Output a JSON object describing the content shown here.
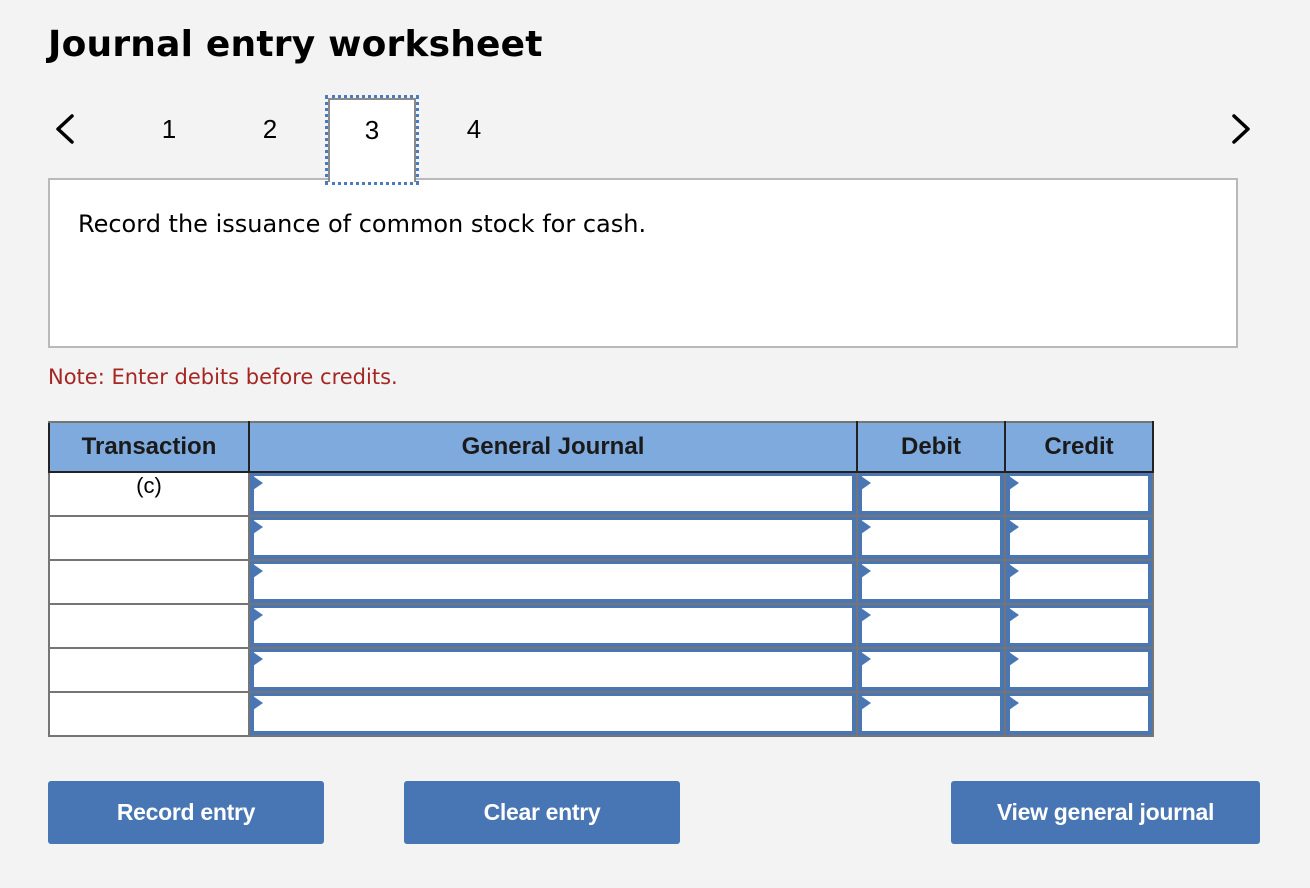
{
  "page": {
    "title": "Journal entry worksheet"
  },
  "navigation": {
    "prev_icon": "chevron-left-icon",
    "next_icon": "chevron-right-icon",
    "tabs": [
      {
        "label": "1",
        "active": false
      },
      {
        "label": "2",
        "active": false
      },
      {
        "label": "3",
        "active": true
      },
      {
        "label": "4",
        "active": false
      }
    ]
  },
  "prompt": {
    "text": "Record the issuance of common stock for cash."
  },
  "note": {
    "text": "Note: Enter debits before credits.",
    "color": "#a52622"
  },
  "journal_table": {
    "headers": {
      "transaction": "Transaction",
      "general_journal": "General Journal",
      "debit": "Debit",
      "credit": "Credit"
    },
    "header_color": "#7faadd",
    "rows": [
      {
        "transaction": "(c)",
        "account": "",
        "debit": "",
        "credit": ""
      },
      {
        "transaction": "",
        "account": "",
        "debit": "",
        "credit": ""
      },
      {
        "transaction": "",
        "account": "",
        "debit": "",
        "credit": ""
      },
      {
        "transaction": "",
        "account": "",
        "debit": "",
        "credit": ""
      },
      {
        "transaction": "",
        "account": "",
        "debit": "",
        "credit": ""
      },
      {
        "transaction": "",
        "account": "",
        "debit": "",
        "credit": ""
      }
    ]
  },
  "buttons": {
    "record_entry": "Record entry",
    "clear_entry": "Clear entry",
    "view_general_journal": "View general journal",
    "color": "#4875b3"
  }
}
